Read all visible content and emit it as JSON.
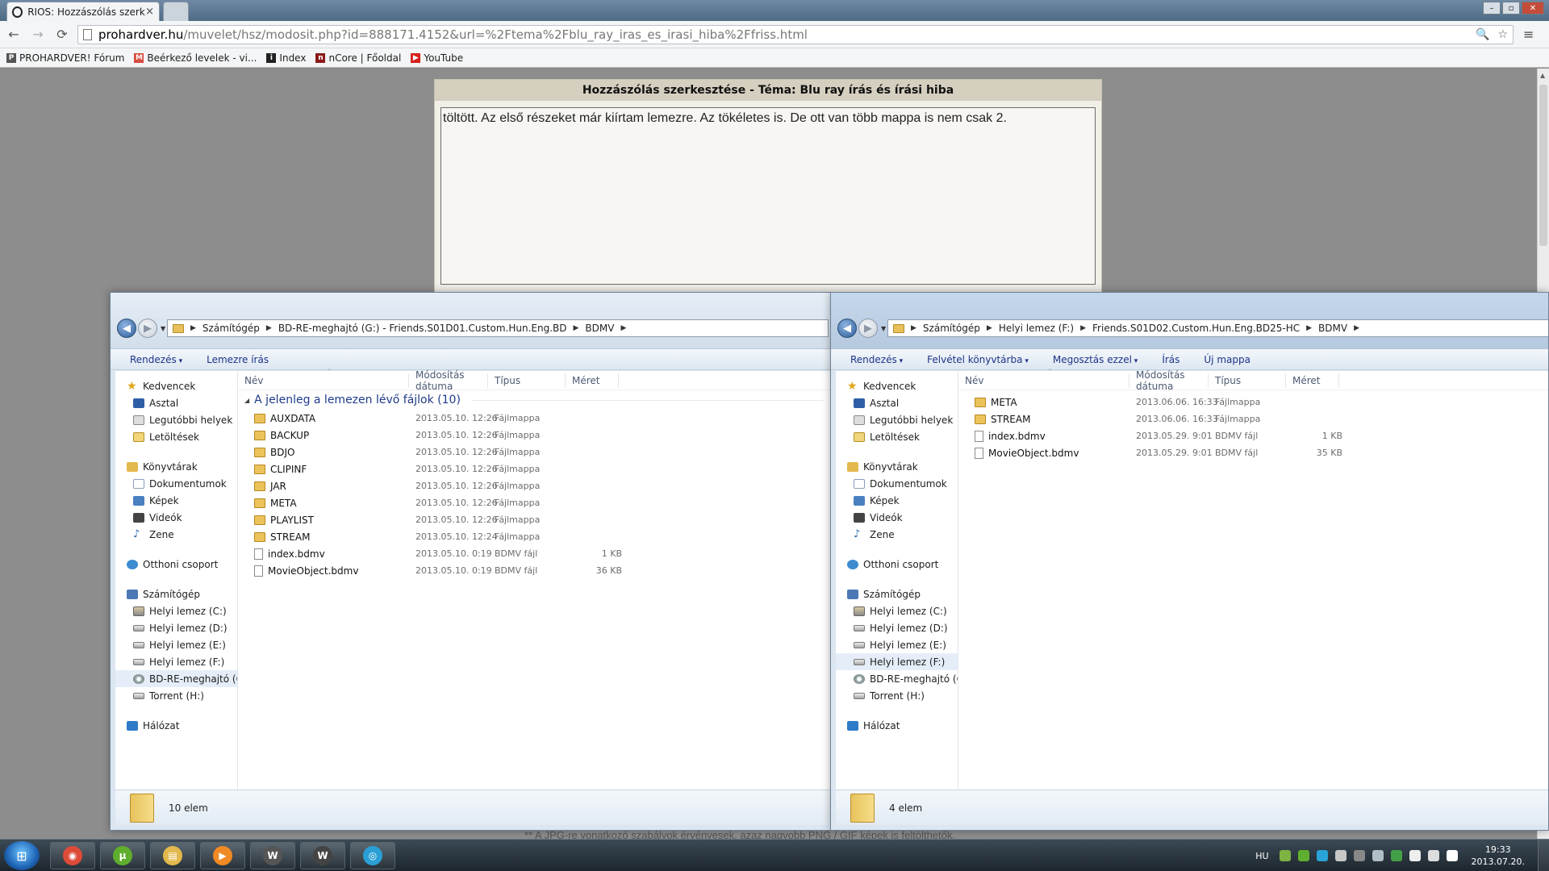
{
  "browser": {
    "tab_title": "RIOS: Hozzászólás szerkes",
    "tab_close": "×",
    "url_domain": "prohardver.hu",
    "url_path": "/muvelet/hsz/modosit.php?id=888171.4152&url=%2Ftema%2Fblu_ray_iras_es_irasi_hiba%2Ffriss.html",
    "back_glyph": "←",
    "forward_glyph": "→",
    "reload_glyph": "⟳",
    "zoom_glyph": "🔍",
    "star_glyph": "☆",
    "menu_glyph": "≡",
    "window_min": "–",
    "window_max": "▫",
    "window_close": "✕",
    "bookmarks": [
      {
        "label": "PROHARDVER! Fórum",
        "icon": "prohardver-icon",
        "color": "#555555",
        "glyph": "P"
      },
      {
        "label": "Beérkező levelek - vi...",
        "icon": "gmail-icon",
        "color": "#d54b3d",
        "glyph": "M"
      },
      {
        "label": "Index",
        "icon": "index-icon",
        "color": "#222222",
        "glyph": "i"
      },
      {
        "label": "nCore | Főoldal",
        "icon": "ncore-icon",
        "color": "#8b1a1a",
        "glyph": "n"
      },
      {
        "label": "YouTube",
        "icon": "youtube-icon",
        "color": "#d4221c",
        "glyph": "▶"
      }
    ]
  },
  "editor": {
    "title": "Hozzászólás szerkesztése - Téma: Blu ray írás és írási hiba",
    "text": "töltött. Az első részeket már kiírtam lemezre. Az tökéletes is. De ott van több mappa is nem csak 2.",
    "footer": "** A JPG-re vonatkozó szabályok érvényesek, azaz nagyobb PNG / GIF képek is feltölthetők."
  },
  "explorer_left": {
    "breadcrumb": [
      "Számítógép",
      "BD-RE-meghajtó (G:) - Friends.S01D01.Custom.Hun.Eng.BD",
      "BDMV"
    ],
    "commands": [
      {
        "label": "Rendezés",
        "dropdown": true
      },
      {
        "label": "Lemezre írás",
        "dropdown": false
      }
    ],
    "columns": {
      "name": "Név",
      "date": "Módosítás dátuma",
      "type": "Típus",
      "size": "Méret"
    },
    "group_label": "A jelenleg a lemezen lévő fájlok (10)",
    "files": [
      {
        "name": "AUXDATA",
        "date": "2013.05.10. 12:26",
        "type": "Fájlmappa",
        "size": "",
        "kind": "folder"
      },
      {
        "name": "BACKUP",
        "date": "2013.05.10. 12:26",
        "type": "Fájlmappa",
        "size": "",
        "kind": "folder"
      },
      {
        "name": "BDJO",
        "date": "2013.05.10. 12:26",
        "type": "Fájlmappa",
        "size": "",
        "kind": "folder"
      },
      {
        "name": "CLIPINF",
        "date": "2013.05.10. 12:26",
        "type": "Fájlmappa",
        "size": "",
        "kind": "folder"
      },
      {
        "name": "JAR",
        "date": "2013.05.10. 12:26",
        "type": "Fájlmappa",
        "size": "",
        "kind": "folder"
      },
      {
        "name": "META",
        "date": "2013.05.10. 12:26",
        "type": "Fájlmappa",
        "size": "",
        "kind": "folder"
      },
      {
        "name": "PLAYLIST",
        "date": "2013.05.10. 12:26",
        "type": "Fájlmappa",
        "size": "",
        "kind": "folder"
      },
      {
        "name": "STREAM",
        "date": "2013.05.10. 12:24",
        "type": "Fájlmappa",
        "size": "",
        "kind": "folder"
      },
      {
        "name": "index.bdmv",
        "date": "2013.05.10. 0:19",
        "type": "BDMV fájl",
        "size": "1 KB",
        "kind": "file"
      },
      {
        "name": "MovieObject.bdmv",
        "date": "2013.05.10. 0:19",
        "type": "BDMV fájl",
        "size": "36 KB",
        "kind": "file"
      }
    ],
    "status": "10 elem",
    "selected_nav": "BD-RE-meghajtó (G:"
  },
  "explorer_right": {
    "breadcrumb": [
      "Számítógép",
      "Helyi lemez (F:)",
      "Friends.S01D02.Custom.Hun.Eng.BD25-HC",
      "BDMV"
    ],
    "commands": [
      {
        "label": "Rendezés",
        "dropdown": true
      },
      {
        "label": "Felvétel könyvtárba",
        "dropdown": true
      },
      {
        "label": "Megosztás ezzel",
        "dropdown": true
      },
      {
        "label": "Írás",
        "dropdown": false
      },
      {
        "label": "Új mappa",
        "dropdown": false
      }
    ],
    "columns": {
      "name": "Név",
      "date": "Módosítás dátuma",
      "type": "Típus",
      "size": "Méret"
    },
    "files": [
      {
        "name": "META",
        "date": "2013.06.06. 16:33",
        "type": "Fájlmappa",
        "size": "",
        "kind": "folder"
      },
      {
        "name": "STREAM",
        "date": "2013.06.06. 16:33",
        "type": "Fájlmappa",
        "size": "",
        "kind": "folder"
      },
      {
        "name": "index.bdmv",
        "date": "2013.05.29. 9:01",
        "type": "BDMV fájl",
        "size": "1 KB",
        "kind": "file"
      },
      {
        "name": "MovieObject.bdmv",
        "date": "2013.05.29. 9:01",
        "type": "BDMV fájl",
        "size": "35 KB",
        "kind": "file"
      }
    ],
    "status": "4 elem",
    "selected_nav": "Helyi lemez (F:)"
  },
  "navpane": {
    "groups": [
      [
        {
          "label": "Kedvencek",
          "icon": "star-icon",
          "head": true
        },
        {
          "label": "Asztal",
          "icon": "desktop-icon"
        },
        {
          "label": "Legutóbbi helyek",
          "icon": "recent-places-icon"
        },
        {
          "label": "Letöltések",
          "icon": "downloads-icon"
        }
      ],
      [
        {
          "label": "Könyvtárak",
          "icon": "libraries-icon",
          "head": true
        },
        {
          "label": "Dokumentumok",
          "icon": "documents-icon"
        },
        {
          "label": "Képek",
          "icon": "pictures-icon"
        },
        {
          "label": "Videók",
          "icon": "videos-icon"
        },
        {
          "label": "Zene",
          "icon": "music-icon"
        }
      ],
      [
        {
          "label": "Otthoni csoport",
          "icon": "homegroup-icon",
          "head": true
        }
      ],
      [
        {
          "label": "Számítógép",
          "icon": "computer-icon",
          "head": true
        },
        {
          "label": "Helyi lemez (C:)",
          "icon": "system-drive-icon"
        },
        {
          "label": "Helyi lemez (D:)",
          "icon": "drive-icon"
        },
        {
          "label": "Helyi lemez (E:)",
          "icon": "drive-icon"
        },
        {
          "label": "Helyi lemez (F:)",
          "icon": "drive-icon"
        },
        {
          "label": "BD-RE-meghajtó (G:",
          "icon": "disc-drive-icon"
        },
        {
          "label": "Torrent (H:)",
          "icon": "drive-icon"
        }
      ],
      [
        {
          "label": "Hálózat",
          "icon": "network-icon",
          "head": true
        }
      ]
    ]
  },
  "taskbar": {
    "start_glyph": "⊞",
    "apps": [
      {
        "name": "chrome-icon",
        "color": "#dd4b39",
        "glyph": "◉"
      },
      {
        "name": "utorrent-icon",
        "color": "#5fae2e",
        "glyph": "µ"
      },
      {
        "name": "explorer-icon",
        "color": "#e3b84c",
        "glyph": "▤"
      },
      {
        "name": "media-player-icon",
        "color": "#f08a24",
        "glyph": "▶"
      },
      {
        "name": "world-of-tanks-icon",
        "color": "#555555",
        "glyph": "W"
      },
      {
        "name": "world-of-tanks-icon-2",
        "color": "#444444",
        "glyph": "W"
      },
      {
        "name": "steam-like-icon",
        "color": "#2a9fd6",
        "glyph": "◎"
      }
    ],
    "tray": {
      "lang": "HU",
      "time": "19:33",
      "date": "2013.07.20.",
      "icons": [
        {
          "name": "tray-app-icon",
          "color": "#7cb342"
        },
        {
          "name": "utorrent-tray-icon",
          "color": "#5fae2e"
        },
        {
          "name": "tray-circle-icon",
          "color": "#29a3d8"
        },
        {
          "name": "steam-tray-icon",
          "color": "#c8c8c8"
        },
        {
          "name": "tray-misc-icon",
          "color": "#888888"
        },
        {
          "name": "tray-app-2-icon",
          "color": "#b0bec5"
        },
        {
          "name": "tray-green-icon",
          "color": "#43a047"
        },
        {
          "name": "flag-icon",
          "color": "#eeeeee"
        },
        {
          "name": "display-icon",
          "color": "#dddddd"
        },
        {
          "name": "volume-icon",
          "color": "#ffffff"
        }
      ]
    }
  }
}
